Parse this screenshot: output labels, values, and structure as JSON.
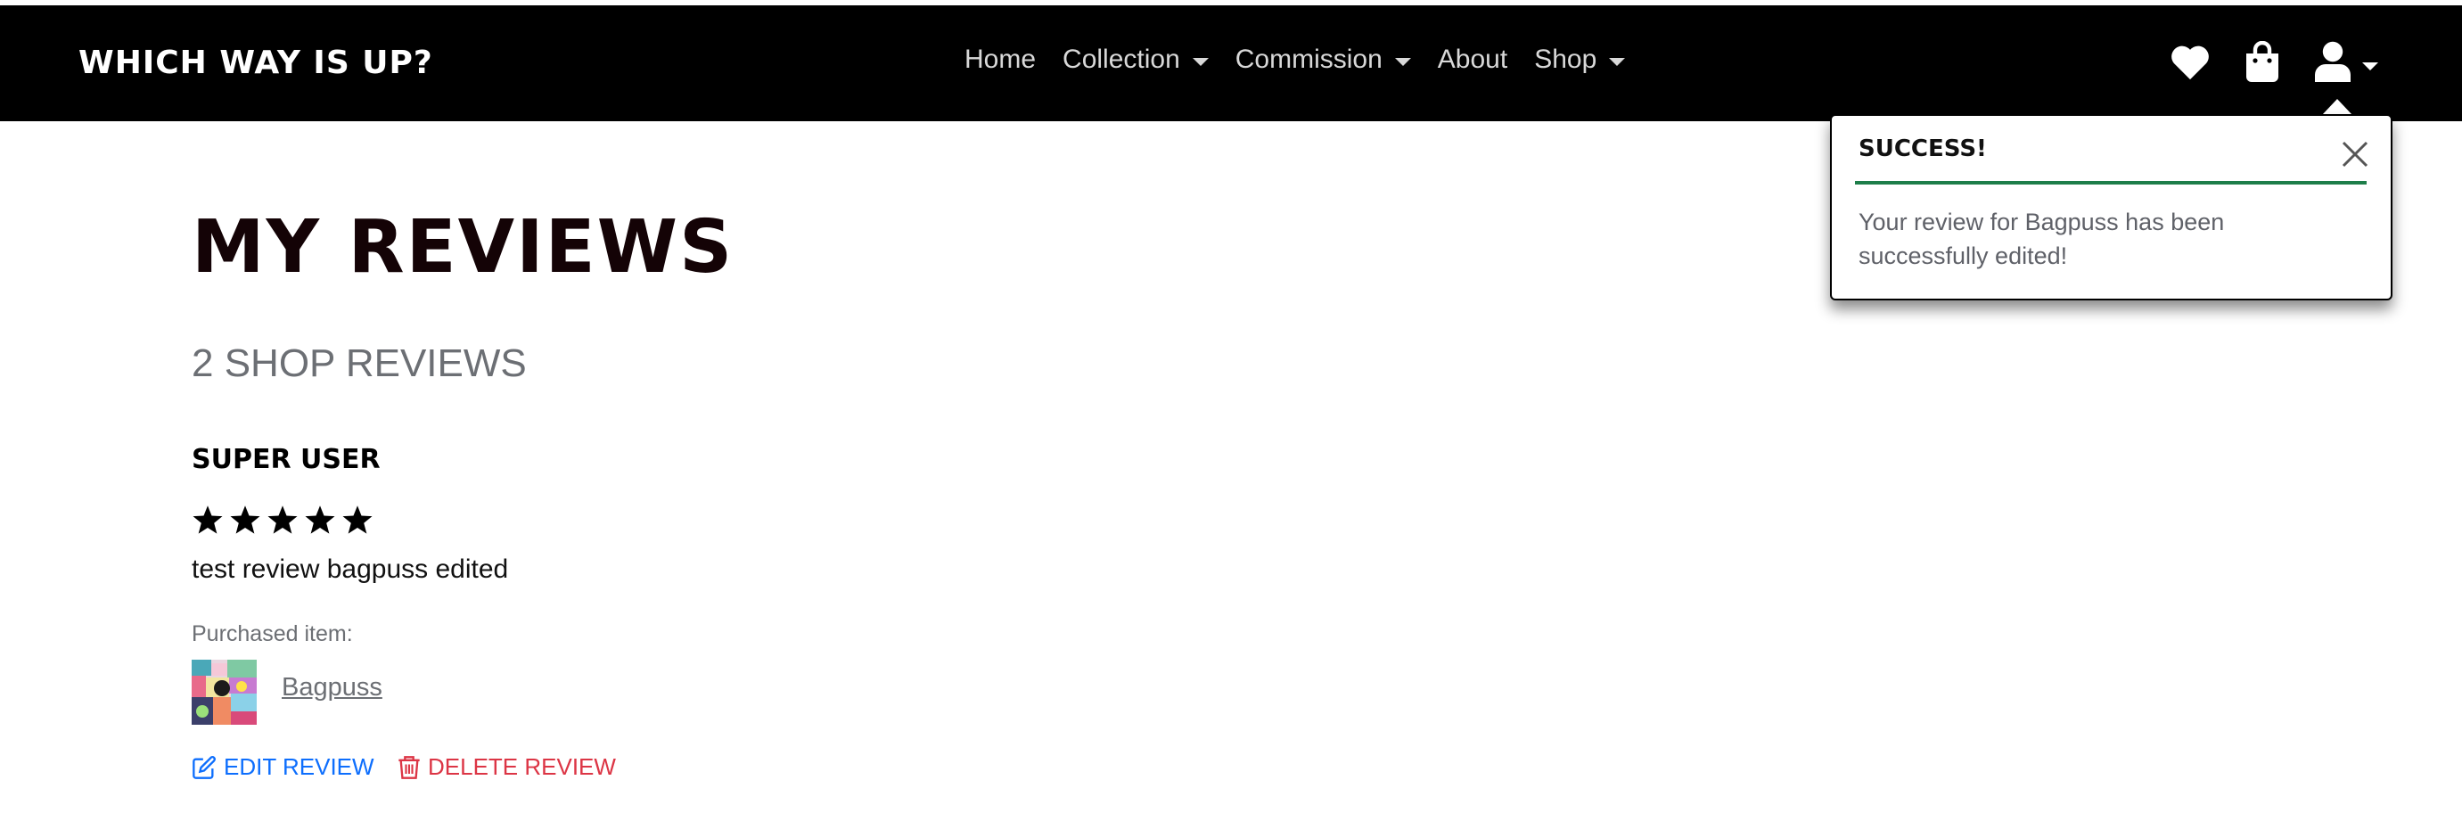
{
  "navbar": {
    "brand": "Which Way Is Up?",
    "links": [
      {
        "label": "Home",
        "dropdown": false
      },
      {
        "label": "Collection",
        "dropdown": true
      },
      {
        "label": "Commission",
        "dropdown": true
      },
      {
        "label": "About",
        "dropdown": false
      },
      {
        "label": "Shop",
        "dropdown": true
      }
    ],
    "icons": [
      "heart-icon",
      "shopping-bag-icon",
      "user-icon"
    ]
  },
  "toast": {
    "title": "Success!",
    "message": "Your review for Bagpuss has been successfully edited!",
    "accent_color": "#1e7e4a"
  },
  "page": {
    "title": "My Reviews",
    "count_label": "2 Shop Reviews"
  },
  "review": {
    "reviewer": "Super User",
    "rating": 5,
    "rating_max": 5,
    "text": "test review bagpuss edited",
    "purchased_label": "Purchased item:",
    "item_name": "Bagpuss",
    "edit_label": "Edit Review",
    "delete_label": "Delete Review",
    "edit_color": "#0d6efd",
    "delete_color": "#dc3545"
  }
}
